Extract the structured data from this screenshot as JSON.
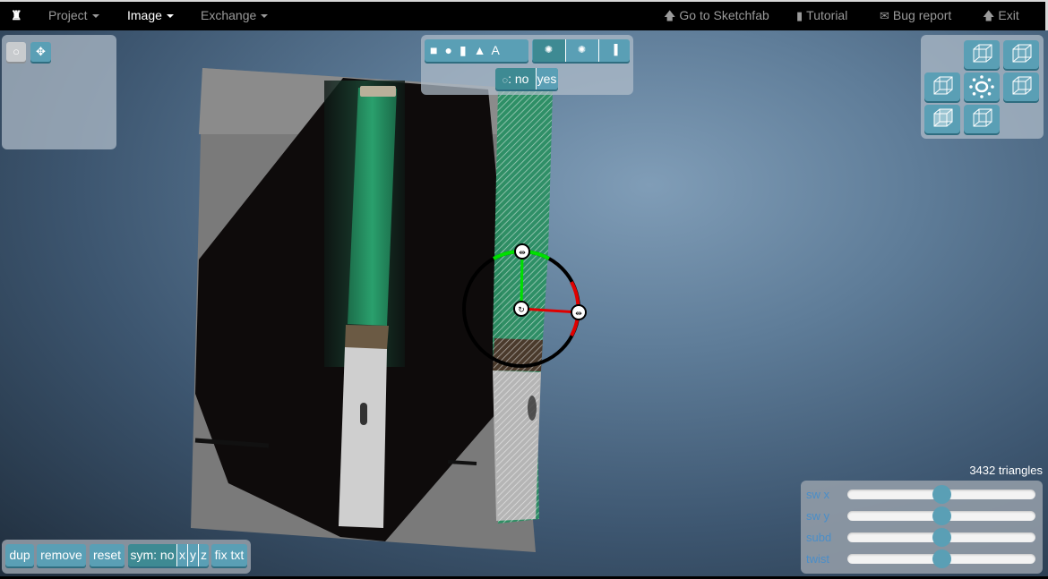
{
  "navbar": {
    "logo": "sculptgl-logo-icon",
    "menus": [
      {
        "label": "Project",
        "active": false
      },
      {
        "label": "Image",
        "active": true
      },
      {
        "label": "Exchange",
        "active": false
      }
    ],
    "links": [
      {
        "label": "Go to Sketchfab",
        "icon": "arrow-up-icon"
      },
      {
        "label": "Tutorial",
        "icon": "book-icon"
      },
      {
        "label": "Bug report",
        "icon": "envelope-icon"
      },
      {
        "label": "Exit",
        "icon": "arrow-up-icon"
      }
    ]
  },
  "left_panel": {
    "tools": [
      {
        "name": "rotate-tool",
        "icon": "circle-outline-icon",
        "active": false
      },
      {
        "name": "move-tool",
        "icon": "move-arrows-icon",
        "active": true
      }
    ]
  },
  "shape_toolbar": {
    "primitives": [
      {
        "name": "cube",
        "glyph": "■"
      },
      {
        "name": "sphere",
        "glyph": "●"
      },
      {
        "name": "cylinder",
        "glyph": "▮"
      },
      {
        "name": "cone",
        "glyph": "▲"
      },
      {
        "name": "text",
        "glyph": "A"
      }
    ],
    "modes": [
      {
        "name": "mode-1",
        "active": true
      },
      {
        "name": "mode-2",
        "active": false
      },
      {
        "name": "mode-3",
        "active": false
      }
    ],
    "toggle": {
      "label": ": ",
      "no": "no",
      "yes": "yes",
      "selected": "no"
    }
  },
  "view_cube": {
    "buttons": [
      "top-view",
      "back-view",
      "left-view",
      "reset-view",
      "right-view",
      "front-view",
      "bottom-view"
    ]
  },
  "bottom_toolbar": {
    "dup": "dup",
    "remove": "remove",
    "reset": "reset",
    "sym_label": "sym: no",
    "sym_x": "x",
    "sym_y": "y",
    "sym_z": "z",
    "fix_txt": "fix txt"
  },
  "stats": {
    "triangles": "3432 triangles"
  },
  "sliders": [
    {
      "label": "sw x",
      "value": 0.5
    },
    {
      "label": "sw y",
      "value": 0.5
    },
    {
      "label": "subd",
      "value": 0.5
    },
    {
      "label": "twist",
      "value": 0.5
    }
  ],
  "colors": {
    "accent": "#5a9fb5",
    "accent_dark": "#3e8a93",
    "label_blue": "#4a8ec8",
    "gizmo_green": "#00e000",
    "gizmo_red": "#e00000"
  }
}
